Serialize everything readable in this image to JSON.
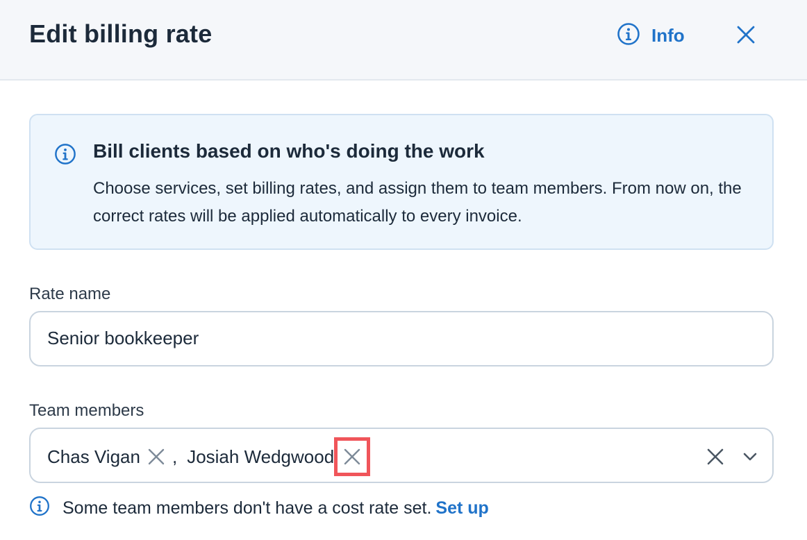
{
  "header": {
    "title": "Edit billing rate",
    "info_label": "Info",
    "info_icon": "info-circle-icon",
    "close_icon": "close-icon"
  },
  "banner": {
    "icon": "info-circle-icon",
    "title": "Bill clients based on who's doing the work",
    "body": "Choose services, set billing rates, and assign them to team members. From now on, the correct rates will be applied automatically to every invoice."
  },
  "rate_name": {
    "label": "Rate name",
    "value": "Senior bookkeeper"
  },
  "team_members": {
    "label": "Team members",
    "selected": [
      "Chas Vigan",
      "Josiah Wedgwood"
    ],
    "separator": ","
  },
  "hint": {
    "text": "Some team members don't have a cost rate set.",
    "link": "Set up"
  },
  "colors": {
    "accent": "#2073c9",
    "highlight": "#f0555a",
    "banner_bg": "#eef6fd",
    "header_bg": "#f5f7fa"
  }
}
